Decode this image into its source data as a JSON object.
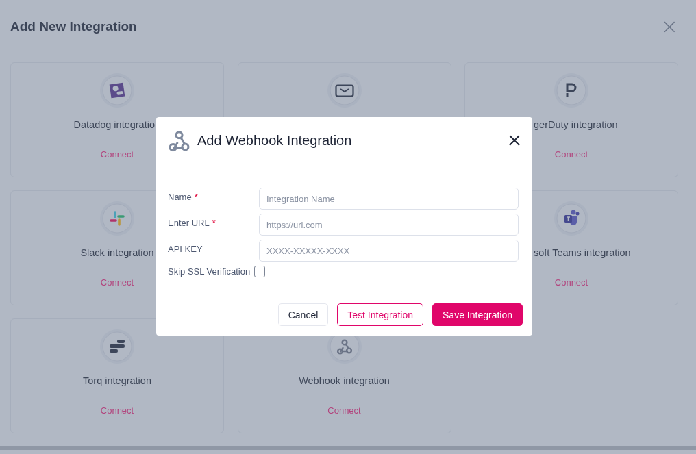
{
  "page": {
    "title": "Add New Integration",
    "close": "×"
  },
  "rows": [
    {
      "cards": [
        {
          "kind": "full",
          "name": "Datadog integratio",
          "action": "Connect"
        },
        {
          "kind": "icon_only"
        },
        {
          "kind": "full",
          "name": "gerDuty integration",
          "action": "Connect"
        }
      ]
    },
    {
      "cards": [
        {
          "kind": "full",
          "name": "Slack integration",
          "action": "Connect"
        },
        {
          "kind": "full",
          "name": "soft Teams integration",
          "action": "Connect"
        }
      ]
    },
    {
      "cards": [
        {
          "kind": "full",
          "name": "Torq integration",
          "action": "Connect"
        },
        {
          "kind": "full",
          "name": "Webhook integration",
          "action": "Connect"
        }
      ]
    }
  ],
  "dialog": {
    "title": "Add Webhook Integration",
    "fields": [
      {
        "kind": "text",
        "label": "Name",
        "marker": "*",
        "placeholder": "Integration Name"
      },
      {
        "kind": "text",
        "label": "Enter URL",
        "marker": "*",
        "placeholder": "https://url.com"
      },
      {
        "kind": "text",
        "label": "API KEY",
        "placeholder": "XXXX-XXXXX-XXXX"
      },
      {
        "kind": "checkbox",
        "label": "Skip SSL Verification",
        "checked": false
      }
    ],
    "buttons": [
      {
        "kind": "plain",
        "label": "Cancel"
      },
      {
        "kind": "outline",
        "label": "Test Integration"
      },
      {
        "kind": "primary",
        "label": "Save Integration"
      }
    ]
  }
}
